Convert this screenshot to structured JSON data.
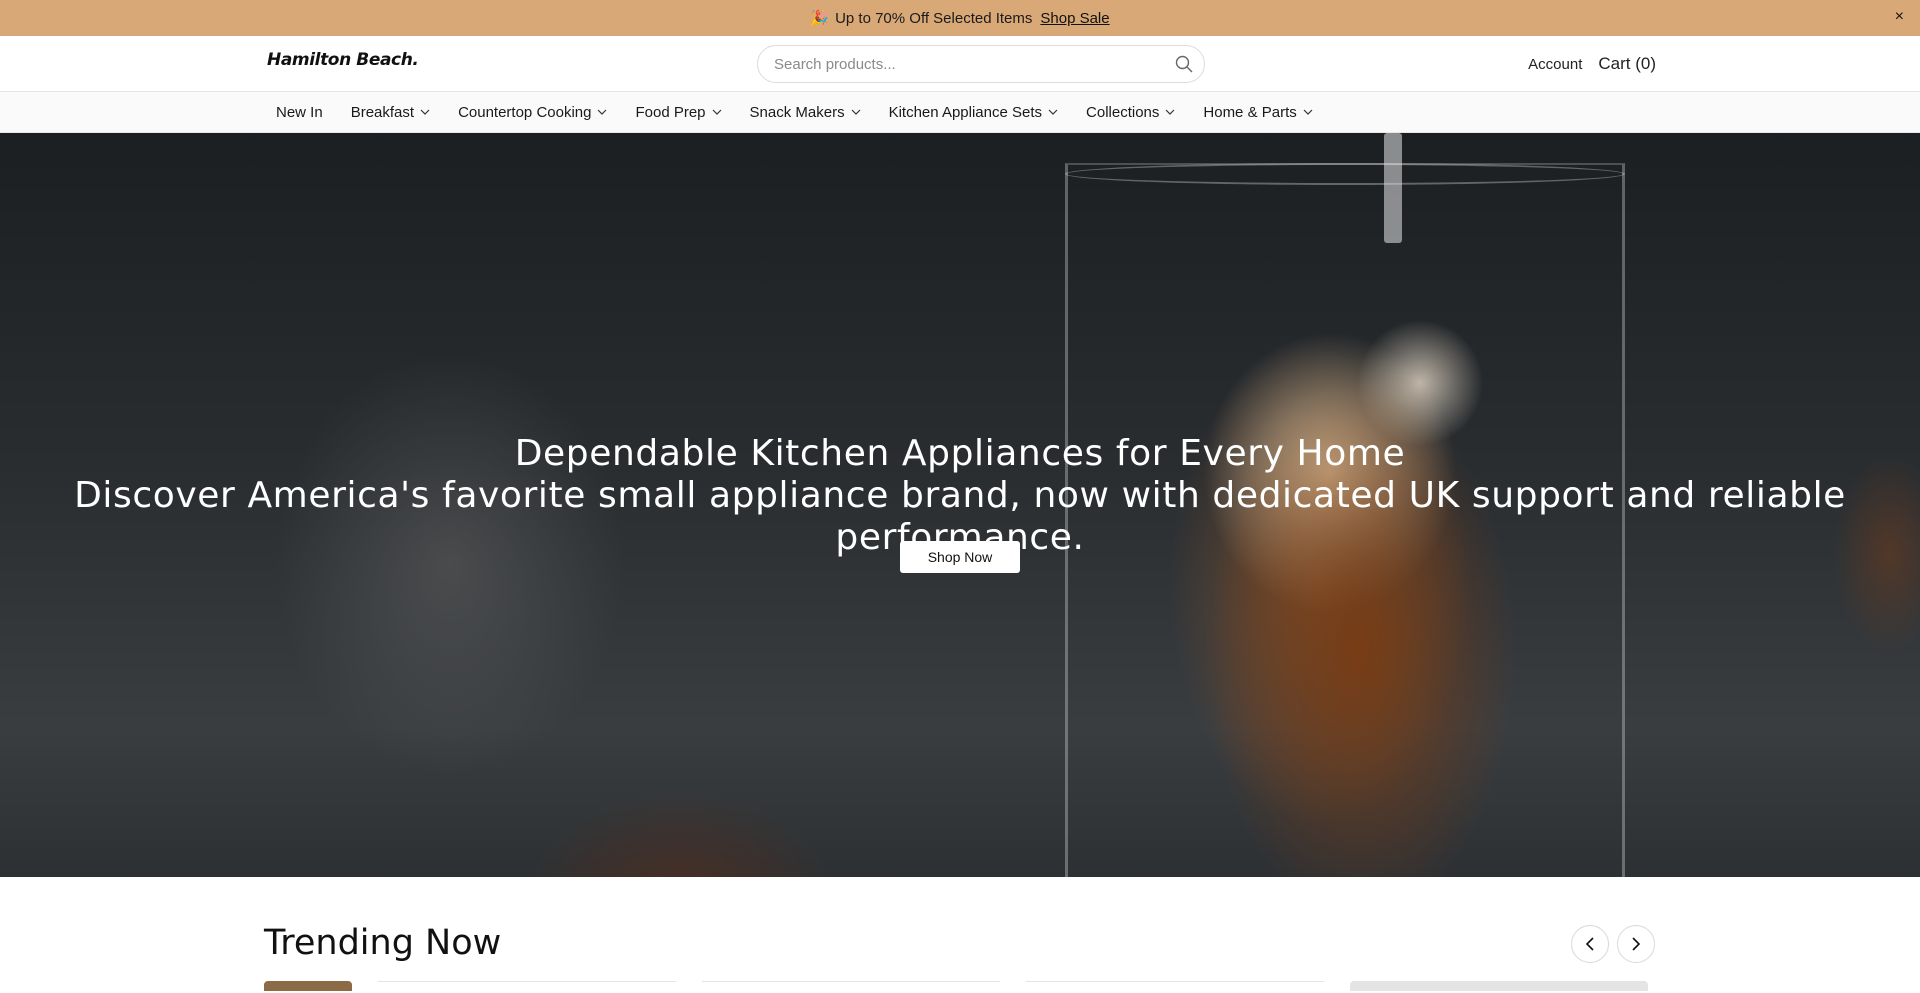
{
  "announcement": {
    "emoji": "🎉",
    "text": "Up to 70% Off Selected Items",
    "link": "Shop Sale",
    "close": "×"
  },
  "header": {
    "logo": "Hamilton Beach.",
    "search_placeholder": "Search products...",
    "account": "Account",
    "cart": "Cart (0)"
  },
  "nav": {
    "items": [
      {
        "label": "New In",
        "dropdown": false
      },
      {
        "label": "Breakfast",
        "dropdown": true
      },
      {
        "label": "Countertop Cooking",
        "dropdown": true
      },
      {
        "label": "Food Prep",
        "dropdown": true
      },
      {
        "label": "Snack Makers",
        "dropdown": true
      },
      {
        "label": "Kitchen Appliance Sets",
        "dropdown": true
      },
      {
        "label": "Collections",
        "dropdown": true
      },
      {
        "label": "Home & Parts",
        "dropdown": true
      }
    ]
  },
  "hero": {
    "title": "Dependable Kitchen Appliances for Every Home",
    "subtitle": "Discover America's favorite small appliance brand, now with dedicated UK support and reliable performance.",
    "cta": "Shop Now"
  },
  "trending": {
    "title": "Trending Now"
  },
  "colors": {
    "announcement_bg": "#d9a877",
    "nav_bg": "#fafafa",
    "hero_button_bg": "#ffffff"
  }
}
